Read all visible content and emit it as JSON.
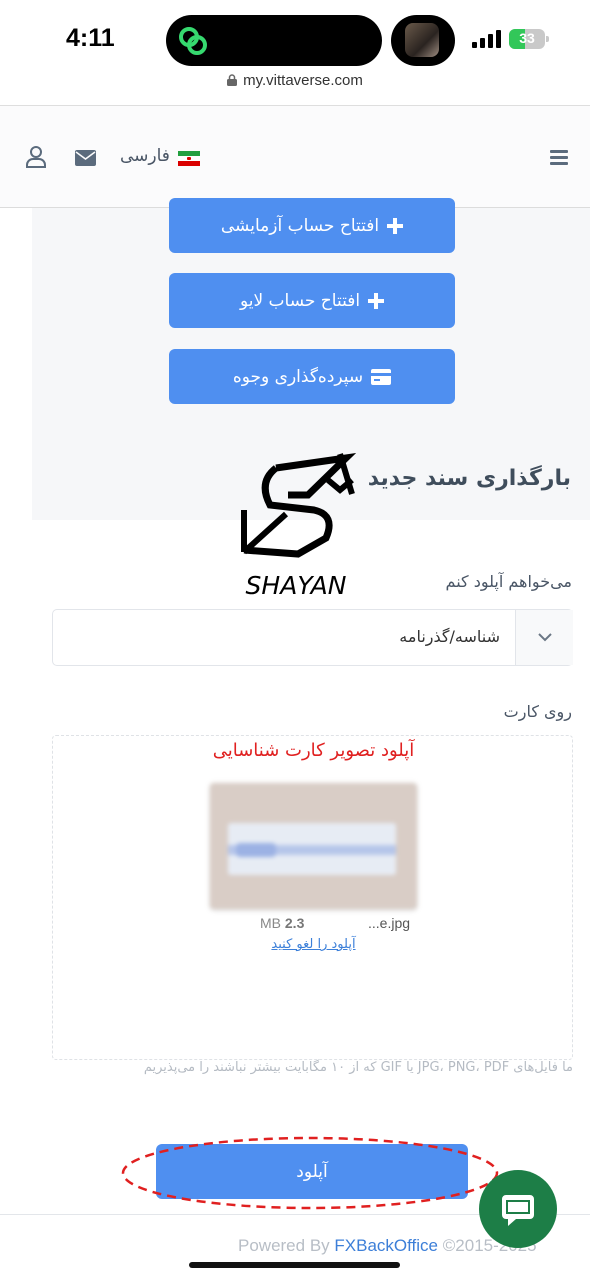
{
  "status_bar": {
    "time": "4:11",
    "battery": "33",
    "url": "my.vittaverse.com"
  },
  "header": {
    "language": "فارسی",
    "icons": [
      "hamburger-menu-icon",
      "iran-flag-icon",
      "mail-icon",
      "user-icon"
    ]
  },
  "panel": {
    "buttons": {
      "demo_account": "افتتاح حساب آزمایشی",
      "live_account": "افتتاح حساب لایو",
      "deposit": "سپرده‌گذاری وجوه"
    },
    "title": "بارگذاری سند جدید"
  },
  "watermark": {
    "text": "SHAYAN"
  },
  "form": {
    "upload_label": "می‌خواهم آپلود کنم",
    "document_type": "شناسه/گذرنامه",
    "front_label": "روی کارت",
    "dropzone_title": "آپلود تصویر کارت شناسایی",
    "file_name": "...e.jpg",
    "file_size_value": "2.3",
    "file_size_unit": "MB",
    "cancel_upload": "آپلود را لغو کنید",
    "hint": "ما فایل‌های JPG، PNG، PDF یا GIF که از ۱۰ مگابایت بیشتر نباشند را می‌پذیریم",
    "submit": "آپلود"
  },
  "footer": {
    "powered_by": "Powered By",
    "brand": "FXBackOffice",
    "copyright": "©2015-2025"
  },
  "colors": {
    "primary": "#4f8ff0",
    "annotation": "#e02020",
    "chat": "#1d7e47"
  }
}
